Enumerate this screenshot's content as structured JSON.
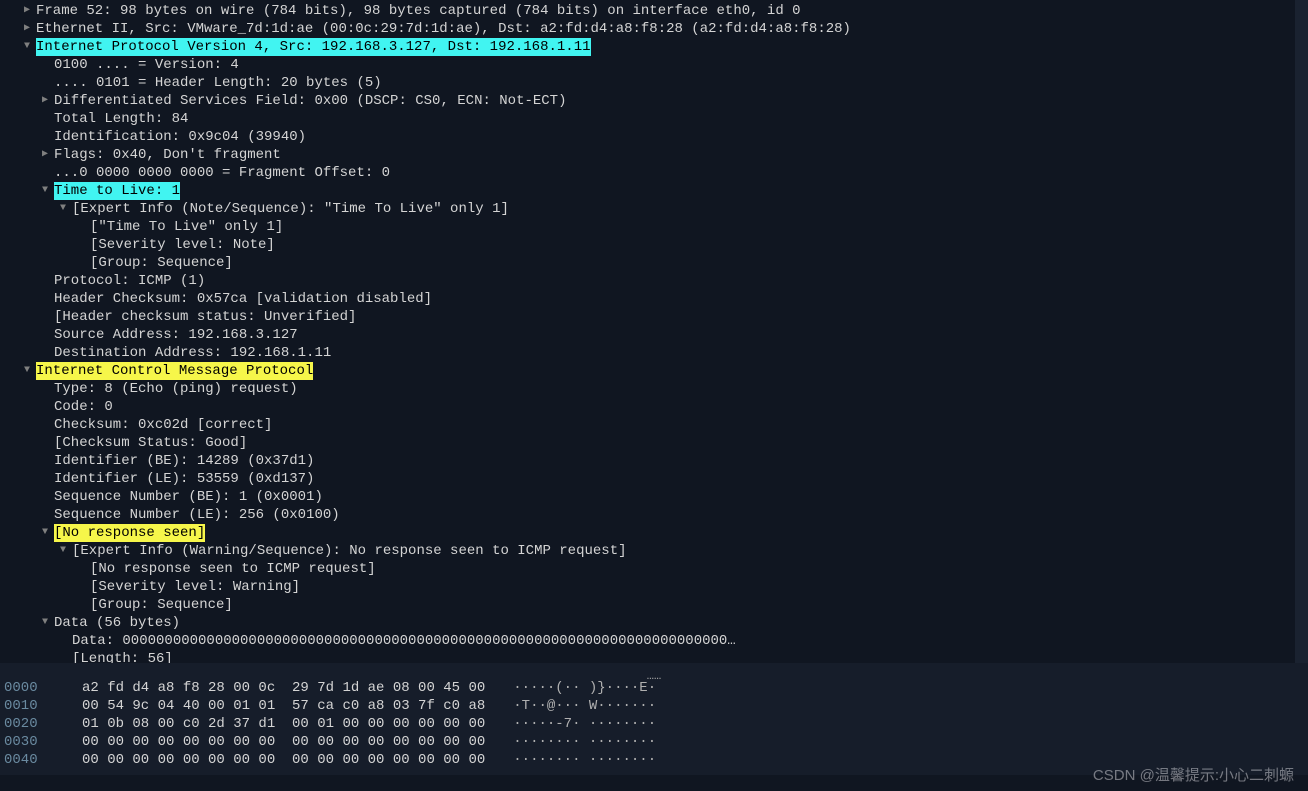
{
  "tree": {
    "frame": "Frame 52: 98 bytes on wire (784 bits), 98 bytes captured (784 bits) on interface eth0, id 0",
    "eth": "Ethernet II, Src: VMware_7d:1d:ae (00:0c:29:7d:1d:ae), Dst: a2:fd:d4:a8:f8:28 (a2:fd:d4:a8:f8:28)",
    "ip_header": "Internet Protocol Version 4, Src: 192.168.3.127, Dst: 192.168.1.11",
    "ip_version": "0100 .... = Version: 4",
    "ip_hlen": ".... 0101 = Header Length: 20 bytes (5)",
    "ip_dscp": "Differentiated Services Field: 0x00 (DSCP: CS0, ECN: Not-ECT)",
    "ip_totlen": "Total Length: 84",
    "ip_ident": "Identification: 0x9c04 (39940)",
    "ip_flags": "Flags: 0x40, Don't fragment",
    "ip_fragoff": "...0 0000 0000 0000 = Fragment Offset: 0",
    "ip_ttl": "Time to Live: 1",
    "ip_ttl_expert": "[Expert Info (Note/Sequence): \"Time To Live\" only 1]",
    "ip_ttl_msg": "[\"Time To Live\" only 1]",
    "ip_ttl_sev": "[Severity level: Note]",
    "ip_ttl_grp": "[Group: Sequence]",
    "ip_proto": "Protocol: ICMP (1)",
    "ip_cksum": "Header Checksum: 0x57ca [validation disabled]",
    "ip_cksum_stat": "[Header checksum status: Unverified]",
    "ip_src": "Source Address: 192.168.3.127",
    "ip_dst": "Destination Address: 192.168.1.11",
    "icmp_header": "Internet Control Message Protocol",
    "icmp_type": "Type: 8 (Echo (ping) request)",
    "icmp_code": "Code: 0",
    "icmp_cksum": "Checksum: 0xc02d [correct]",
    "icmp_cksum_stat": "[Checksum Status: Good]",
    "icmp_id_be": "Identifier (BE): 14289 (0x37d1)",
    "icmp_id_le": "Identifier (LE): 53559 (0xd137)",
    "icmp_seq_be": "Sequence Number (BE): 1 (0x0001)",
    "icmp_seq_le": "Sequence Number (LE): 256 (0x0100)",
    "icmp_noresp": "[No response seen]",
    "icmp_noresp_expert": "[Expert Info (Warning/Sequence): No response seen to ICMP request]",
    "icmp_noresp_msg": "[No response seen to ICMP request]",
    "icmp_noresp_sev": "[Severity level: Warning]",
    "icmp_noresp_grp": "[Group: Sequence]",
    "icmp_data_hdr": "Data (56 bytes)",
    "icmp_data": "Data: 000000000000000000000000000000000000000000000000000000000000000000000000…",
    "icmp_data_len": "[Length: 56]"
  },
  "hex": {
    "r0": {
      "off": "0000",
      "b": "a2 fd d4 a8 f8 28 00 0c  29 7d 1d ae 08 00 45 00",
      "a": "·····(·· )}····E·"
    },
    "r1": {
      "off": "0010",
      "b": "00 54 9c 04 40 00 01 01  57 ca c0 a8 03 7f c0 a8",
      "a": "·T··@··· W·······"
    },
    "r2": {
      "off": "0020",
      "b": "01 0b 08 00 c0 2d 37 d1  00 01 00 00 00 00 00 00",
      "a": "·····-7· ········"
    },
    "r3": {
      "off": "0030",
      "b": "00 00 00 00 00 00 00 00  00 00 00 00 00 00 00 00",
      "a": "········ ········"
    },
    "r4": {
      "off": "0040",
      "b": "00 00 00 00 00 00 00 00  00 00 00 00 00 00 00 00",
      "a": "········ ········"
    }
  },
  "watermark": "CSDN @温馨提示:小心二刺螈"
}
